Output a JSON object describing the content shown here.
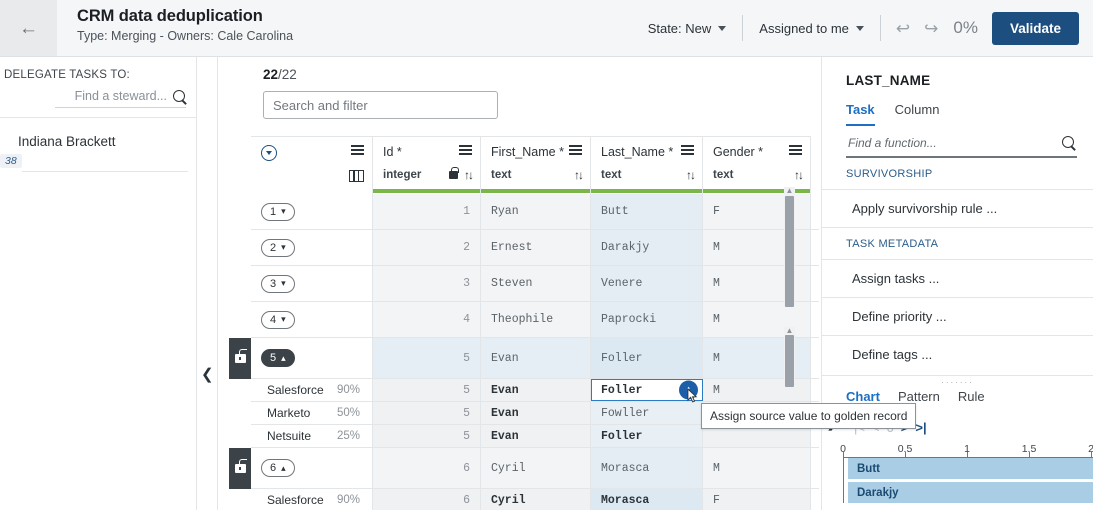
{
  "header": {
    "back_icon": "back-arrow-icon",
    "title": "CRM data deduplication",
    "subtitle": "Type: Merging - Owners: Cale Carolina",
    "state_label": "State: New",
    "assigned_label": "Assigned to me",
    "undo_icon": "undo-icon",
    "redo_icon": "redo-icon",
    "progress": "0%",
    "validate_label": "Validate",
    "accent": "#1c4e80"
  },
  "sidebar": {
    "heading": "DELEGATE TASKS TO:",
    "search_placeholder": "Find a steward...",
    "search_value": "",
    "search_icon": "search-icon",
    "items": [
      {
        "name": "Indiana Brackett",
        "badge": "38"
      }
    ]
  },
  "main": {
    "count_current": "22",
    "count_total": "/22",
    "search_placeholder": "Search and filter",
    "search_value": "",
    "collapse_left_icon": "chevron-left-icon",
    "columns": [
      {
        "name": "",
        "type": "",
        "icons": [
          "burger-menu-icon",
          "column-selector-icon"
        ]
      },
      {
        "name": "Id *",
        "type": "integer",
        "icons": [
          "burger-menu-icon",
          "lock-icon",
          "sort-icon"
        ]
      },
      {
        "name": "First_Name *",
        "type": "text",
        "icons": [
          "burger-menu-icon",
          "sort-icon"
        ]
      },
      {
        "name": "Last_Name *",
        "type": "text",
        "icons": [
          "burger-menu-icon",
          "sort-icon"
        ]
      },
      {
        "name": "Gender *",
        "type": "text",
        "icons": [
          "burger-menu-icon",
          "sort-icon"
        ]
      }
    ],
    "rows": [
      {
        "kind": "master",
        "pill": "1",
        "chevron": "v",
        "id": "1",
        "first": "Ryan",
        "last": "Butt",
        "gender": "F"
      },
      {
        "kind": "master",
        "pill": "2",
        "chevron": "v",
        "id": "2",
        "first": "Ernest",
        "last": "Darakjy",
        "gender": "M"
      },
      {
        "kind": "master",
        "pill": "3",
        "chevron": "v",
        "id": "3",
        "first": "Steven",
        "last": "Venere",
        "gender": "M"
      },
      {
        "kind": "master",
        "pill": "4",
        "chevron": "v",
        "id": "4",
        "first": "Theophile",
        "last": "Paprocki",
        "gender": "M"
      },
      {
        "kind": "group",
        "pill": "5",
        "chevron": "^",
        "id": "5",
        "first": "Evan",
        "last": "Foller",
        "gender": "M",
        "locked": true
      },
      {
        "kind": "source",
        "source": "Salesforce",
        "score": "90%",
        "id": "5",
        "first": "Evan",
        "last": "Foller",
        "gender": "M",
        "selected": true
      },
      {
        "kind": "source",
        "source": "Marketo",
        "score": "50%",
        "id": "5",
        "first": "Evan",
        "last": "Fowller",
        "gender": ""
      },
      {
        "kind": "source",
        "source": "Netsuite",
        "score": "25%",
        "id": "5",
        "first": "Evan",
        "last": "Foller",
        "gender": ""
      },
      {
        "kind": "group",
        "pill": "6",
        "chevron": "^",
        "id": "6",
        "first": "Cyril",
        "last": "Morasca",
        "gender": "M",
        "locked": true
      },
      {
        "kind": "source",
        "source": "Salesforce",
        "score": "90%",
        "id": "6",
        "first": "Cyril",
        "last": "Morasca",
        "gender": "F"
      }
    ],
    "assign_button_icon": "assign-up-arrow-icon",
    "tooltip": "Assign source value to golden record"
  },
  "right_panel": {
    "title": "LAST_NAME",
    "tabs": [
      {
        "label": "Task",
        "active": true
      },
      {
        "label": "Column",
        "active": false
      }
    ],
    "find_placeholder": "Find a function...",
    "find_value": "",
    "find_icon": "search-icon",
    "sections": [
      {
        "label": "SURVIVORSHIP",
        "items": [
          "Apply survivorship rule ..."
        ]
      },
      {
        "label": "TASK METADATA",
        "items": [
          "Assign tasks ...",
          "Define priority ...",
          "Define tags ..."
        ]
      }
    ],
    "collapse_right_icon": "chevron-right-icon",
    "drag_handle_icon": "drag-handle-icon",
    "bottom_tabs": [
      {
        "label": "Chart",
        "active": true
      },
      {
        "label": "Pattern",
        "active": false
      },
      {
        "label": "Rule",
        "active": false
      }
    ],
    "pager": {
      "first": "|<",
      "prev": "<",
      "page": "0",
      "next": ">",
      "last": ">|"
    }
  },
  "chart_data": {
    "type": "bar",
    "orientation": "horizontal",
    "categories": [
      "Butt",
      "Darakjy"
    ],
    "values": [
      2,
      2
    ],
    "title": "",
    "xlabel": "",
    "ylabel": "",
    "xlim": [
      0,
      2
    ],
    "ticks": [
      "0",
      "0.5",
      "1",
      "1.5",
      "2"
    ],
    "grid": true,
    "bar_color": "#a9cde4",
    "label_color": "#1b4a72"
  }
}
